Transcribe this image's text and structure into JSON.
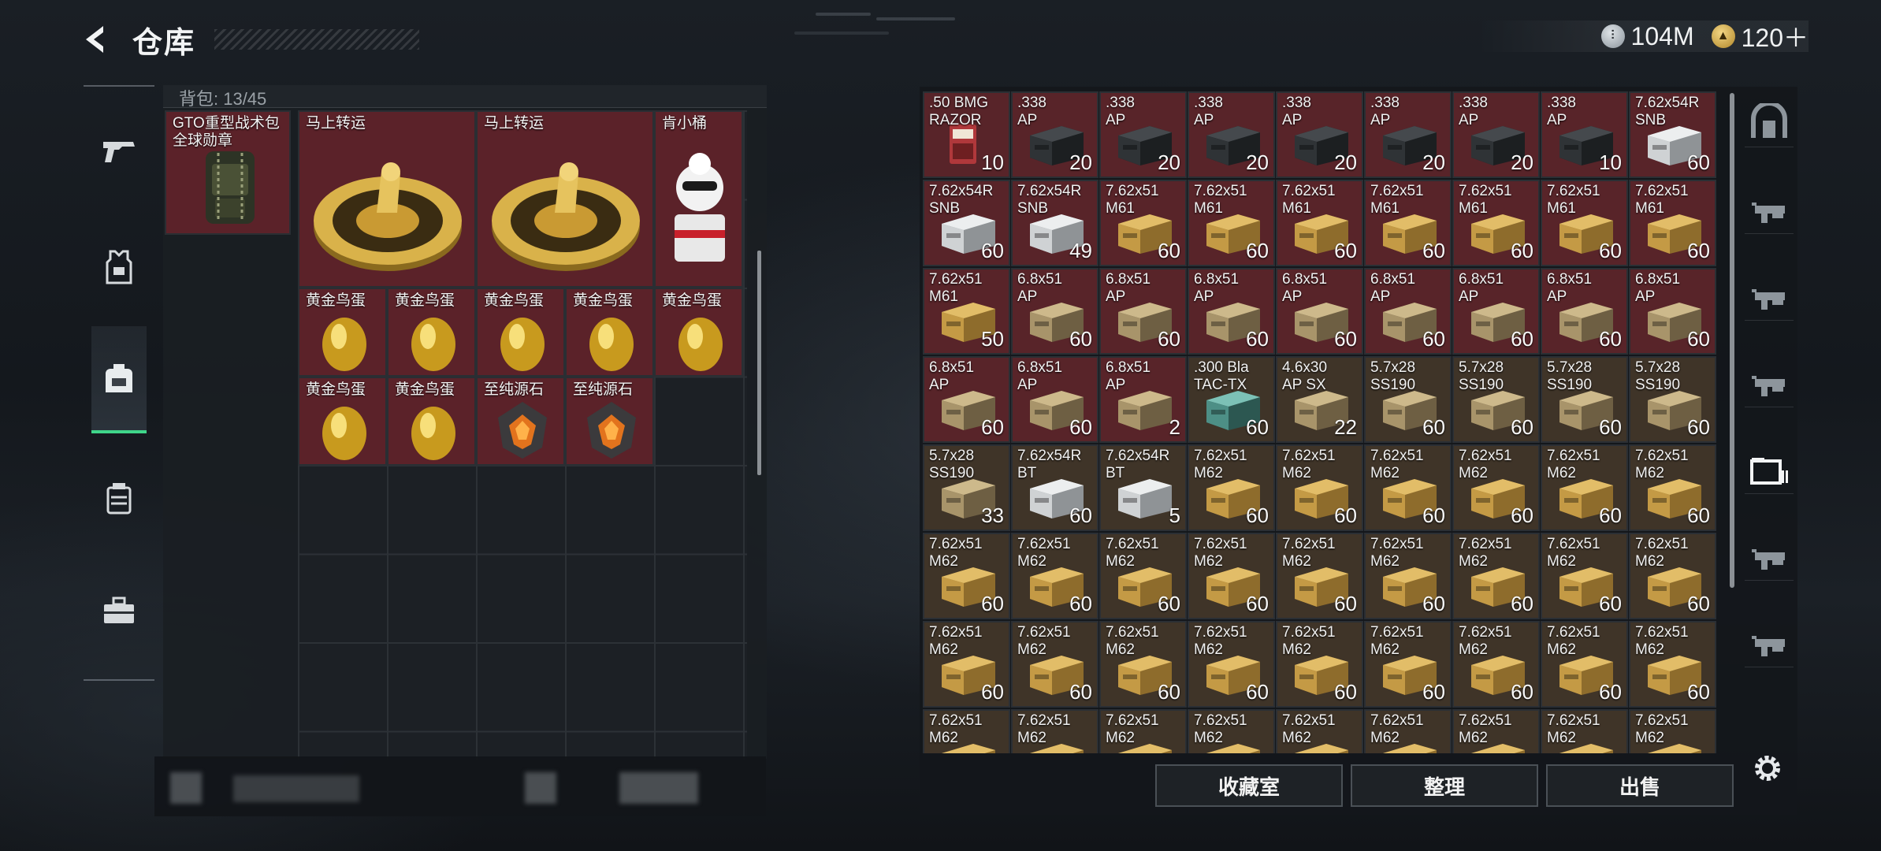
{
  "header": {
    "title": "仓库"
  },
  "currency": [
    {
      "icon": "silver-coin-icon",
      "value": "104M",
      "color": "#9aa4ad"
    },
    {
      "icon": "gold-coin-icon",
      "value": "120＋",
      "color": "#c8a24a"
    }
  ],
  "left_rail": [
    "weapon-tab-icon",
    "armor-tab-icon",
    "backpack-tab-icon",
    "rig-tab-icon",
    "toolbox-tab-icon"
  ],
  "backpack": {
    "capacity_label": "背包: 13/45",
    "items": [
      {
        "name": "GTO重型战术包",
        "name2": "全球勋章",
        "kind": "bag"
      },
      {
        "name": "马上转运",
        "kind": "coin"
      },
      {
        "name": "马上转运",
        "kind": "coin"
      },
      {
        "name": "肯小桶",
        "kind": "mascot"
      },
      {
        "name": "黄金鸟蛋",
        "kind": "egg"
      },
      {
        "name": "黄金鸟蛋",
        "kind": "egg"
      },
      {
        "name": "黄金鸟蛋",
        "kind": "egg"
      },
      {
        "name": "黄金鸟蛋",
        "kind": "egg"
      },
      {
        "name": "黄金鸟蛋",
        "kind": "egg"
      },
      {
        "name": "黄金鸟蛋",
        "kind": "egg"
      },
      {
        "name": "黄金鸟蛋",
        "kind": "egg"
      },
      {
        "name": "至纯源石",
        "kind": "gem"
      },
      {
        "name": "至纯源石",
        "kind": "gem"
      }
    ]
  },
  "stash": [
    [
      [
        "r",
        ".50 BMG\nRAZOR",
        "10",
        "red"
      ],
      [
        "r",
        ".338\nAP",
        "20",
        "dark"
      ],
      [
        "r",
        ".338\nAP",
        "20",
        "dark"
      ],
      [
        "r",
        ".338\nAP",
        "20",
        "dark"
      ],
      [
        "r",
        ".338\nAP",
        "20",
        "dark"
      ],
      [
        "r",
        ".338\nAP",
        "20",
        "dark"
      ],
      [
        "r",
        ".338\nAP",
        "20",
        "dark"
      ],
      [
        "r",
        ".338\nAP",
        "10",
        "dark"
      ],
      [
        "r",
        "7.62x54R\nSNB",
        "60",
        "white"
      ]
    ],
    [
      [
        "r",
        "7.62x54R\nSNB",
        "60",
        "white"
      ],
      [
        "r",
        "7.62x54R\nSNB",
        "49",
        "white"
      ],
      [
        "r",
        "7.62x51\nM61",
        "60",
        "gold"
      ],
      [
        "r",
        "7.62x51\nM61",
        "60",
        "gold"
      ],
      [
        "r",
        "7.62x51\nM61",
        "60",
        "gold"
      ],
      [
        "r",
        "7.62x51\nM61",
        "60",
        "gold"
      ],
      [
        "r",
        "7.62x51\nM61",
        "60",
        "gold"
      ],
      [
        "r",
        "7.62x51\nM61",
        "60",
        "gold"
      ],
      [
        "r",
        "7.62x51\nM61",
        "60",
        "gold"
      ]
    ],
    [
      [
        "r",
        "7.62x51\nM61",
        "50",
        "gold"
      ],
      [
        "r",
        "6.8x51\nAP",
        "60",
        "tan"
      ],
      [
        "r",
        "6.8x51\nAP",
        "60",
        "tan"
      ],
      [
        "r",
        "6.8x51\nAP",
        "60",
        "tan"
      ],
      [
        "r",
        "6.8x51\nAP",
        "60",
        "tan"
      ],
      [
        "r",
        "6.8x51\nAP",
        "60",
        "tan"
      ],
      [
        "r",
        "6.8x51\nAP",
        "60",
        "tan"
      ],
      [
        "r",
        "6.8x51\nAP",
        "60",
        "tan"
      ],
      [
        "r",
        "6.8x51\nAP",
        "60",
        "tan"
      ]
    ],
    [
      [
        "r",
        "6.8x51\nAP",
        "60",
        "tan"
      ],
      [
        "r",
        "6.8x51\nAP",
        "60",
        "tan"
      ],
      [
        "r",
        "6.8x51\nAP",
        "2",
        "tan"
      ],
      [
        "b",
        ".300 Bla\nTAC-TX",
        "60",
        "teal"
      ],
      [
        "b",
        "4.6x30\nAP SX",
        "22",
        "tan"
      ],
      [
        "b",
        "5.7x28\nSS190",
        "60",
        "tan"
      ],
      [
        "b",
        "5.7x28\nSS190",
        "60",
        "tan"
      ],
      [
        "b",
        "5.7x28\nSS190",
        "60",
        "tan"
      ],
      [
        "b",
        "5.7x28\nSS190",
        "60",
        "tan"
      ]
    ],
    [
      [
        "b",
        "5.7x28\nSS190",
        "33",
        "tan"
      ],
      [
        "b",
        "7.62x54R\nBT",
        "60",
        "white"
      ],
      [
        "b",
        "7.62x54R\nBT",
        "5",
        "white"
      ],
      [
        "b",
        "7.62x51\nM62",
        "60",
        "gold"
      ],
      [
        "b",
        "7.62x51\nM62",
        "60",
        "gold"
      ],
      [
        "b",
        "7.62x51\nM62",
        "60",
        "gold"
      ],
      [
        "b",
        "7.62x51\nM62",
        "60",
        "gold"
      ],
      [
        "b",
        "7.62x51\nM62",
        "60",
        "gold"
      ],
      [
        "b",
        "7.62x51\nM62",
        "60",
        "gold"
      ]
    ],
    [
      [
        "b",
        "7.62x51\nM62",
        "60",
        "gold"
      ],
      [
        "b",
        "7.62x51\nM62",
        "60",
        "gold"
      ],
      [
        "b",
        "7.62x51\nM62",
        "60",
        "gold"
      ],
      [
        "b",
        "7.62x51\nM62",
        "60",
        "gold"
      ],
      [
        "b",
        "7.62x51\nM62",
        "60",
        "gold"
      ],
      [
        "b",
        "7.62x51\nM62",
        "60",
        "gold"
      ],
      [
        "b",
        "7.62x51\nM62",
        "60",
        "gold"
      ],
      [
        "b",
        "7.62x51\nM62",
        "60",
        "gold"
      ],
      [
        "b",
        "7.62x51\nM62",
        "60",
        "gold"
      ]
    ],
    [
      [
        "b",
        "7.62x51\nM62",
        "60",
        "gold"
      ],
      [
        "b",
        "7.62x51\nM62",
        "60",
        "gold"
      ],
      [
        "b",
        "7.62x51\nM62",
        "60",
        "gold"
      ],
      [
        "b",
        "7.62x51\nM62",
        "60",
        "gold"
      ],
      [
        "b",
        "7.62x51\nM62",
        "60",
        "gold"
      ],
      [
        "b",
        "7.62x51\nM62",
        "60",
        "gold"
      ],
      [
        "b",
        "7.62x51\nM62",
        "60",
        "gold"
      ],
      [
        "b",
        "7.62x51\nM62",
        "60",
        "gold"
      ],
      [
        "b",
        "7.62x51\nM62",
        "60",
        "gold"
      ]
    ],
    [
      [
        "b",
        "7.62x51\nM62",
        "",
        "gold"
      ],
      [
        "b",
        "7.62x51\nM62",
        "",
        "gold"
      ],
      [
        "b",
        "7.62x51\nM62",
        "",
        "gold"
      ],
      [
        "b",
        "7.62x51\nM62",
        "",
        "gold"
      ],
      [
        "b",
        "7.62x51\nM62",
        "",
        "gold"
      ],
      [
        "b",
        "7.62x51\nM62",
        "",
        "gold"
      ],
      [
        "b",
        "7.62x51\nM62",
        "",
        "gold"
      ],
      [
        "b",
        "7.62x51\nM62",
        "",
        "gold"
      ],
      [
        "b",
        "7.62x51\nM62",
        "",
        "gold"
      ]
    ]
  ],
  "right_rail": [
    "vault-icon",
    "tier4-rifle-icon",
    "tier4-rifle-icon",
    "tier4-rifle-icon",
    "tier4-folder-icon",
    "tier3-rifle-icon",
    "tier4-rifle-icon"
  ],
  "buttons": {
    "collection": "收藏室",
    "sort": "整理",
    "sell": "出售"
  }
}
